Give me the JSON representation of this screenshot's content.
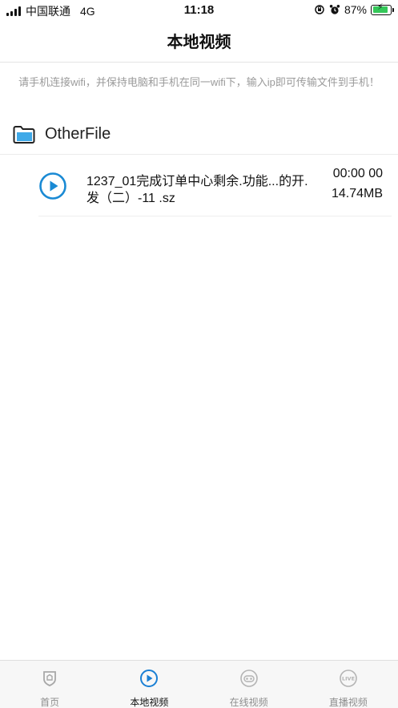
{
  "status_bar": {
    "carrier": "中国联通",
    "network": "4G",
    "time": "11:18",
    "battery_percent": "87%",
    "battery_level": 0.87
  },
  "nav": {
    "title": "本地视频"
  },
  "hint": "请手机连接wifi，并保持电脑和手机在同一wifi下，输入ip即可传输文件到手机！",
  "folder": {
    "name": "OtherFile",
    "icon": "folder-icon"
  },
  "files": [
    {
      "name": "1237_01完成订单中心剩余.功能...的开.发（二）-11 .sz",
      "duration": "00:00 00",
      "size": "14.74MB",
      "icon": "play-circle-icon"
    }
  ],
  "tabs": [
    {
      "label": "首页",
      "icon": "shield-home-icon",
      "active": false
    },
    {
      "label": "本地视频",
      "icon": "play-circle-icon",
      "active": true
    },
    {
      "label": "在线视频",
      "icon": "online-video-icon",
      "active": false
    },
    {
      "label": "直播视频",
      "icon": "live-icon",
      "active": false
    }
  ],
  "colors": {
    "accent": "#1a7fd4",
    "folder_blue": "#3fa9e8",
    "tab_inactive": "#b0b0b0",
    "battery_green": "#34c759"
  }
}
